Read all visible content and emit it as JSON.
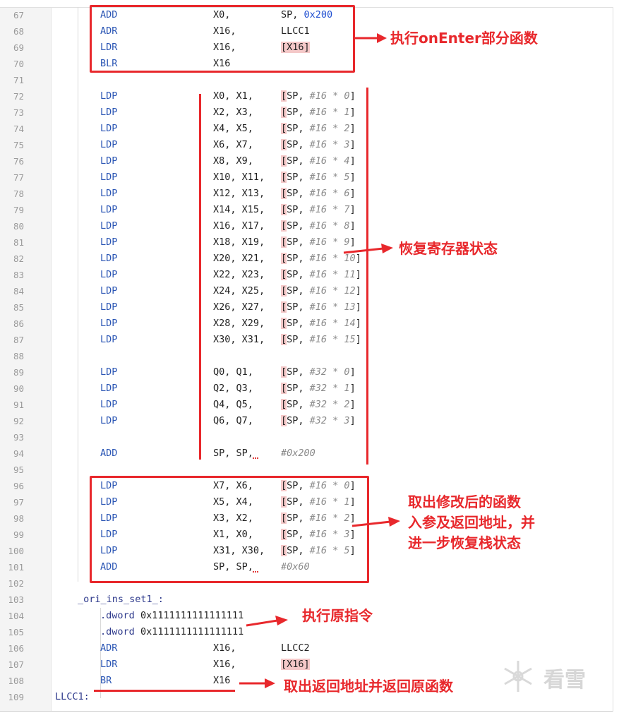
{
  "editor": {
    "lines": [
      {
        "n": "67",
        "mn": "ADD",
        "op1": "X0,",
        "op2": "SP, ",
        "num": "0x200"
      },
      {
        "n": "68",
        "mn": "ADR",
        "op1": "X16,",
        "op2": "LLCC1"
      },
      {
        "n": "69",
        "mn": "LDR",
        "op1": "X16,",
        "op2": "[X16]"
      },
      {
        "n": "70",
        "mn": "BLR",
        "op1": "X16"
      },
      {
        "n": "71"
      },
      {
        "n": "72",
        "mn": "LDP",
        "op1": "X0, X1,",
        "sp": "SP, ",
        "cm": "#16 * 0",
        "close": "]"
      },
      {
        "n": "73",
        "mn": "LDP",
        "op1": "X2, X3,",
        "sp": "SP, ",
        "cm": "#16 * 1",
        "close": "]"
      },
      {
        "n": "74",
        "mn": "LDP",
        "op1": "X4, X5,",
        "sp": "SP, ",
        "cm": "#16 * 2",
        "close": "]"
      },
      {
        "n": "75",
        "mn": "LDP",
        "op1": "X6, X7,",
        "sp": "SP, ",
        "cm": "#16 * 3",
        "close": "]"
      },
      {
        "n": "76",
        "mn": "LDP",
        "op1": "X8, X9,",
        "sp": "SP, ",
        "cm": "#16 * 4",
        "close": "]"
      },
      {
        "n": "77",
        "mn": "LDP",
        "op1": "X10, X11,",
        "sp": "SP, ",
        "cm": "#16 * 5",
        "close": "]"
      },
      {
        "n": "78",
        "mn": "LDP",
        "op1": "X12, X13,",
        "sp": "SP, ",
        "cm": "#16 * 6",
        "close": "]"
      },
      {
        "n": "79",
        "mn": "LDP",
        "op1": "X14, X15,",
        "sp": "SP, ",
        "cm": "#16 * 7",
        "close": "]"
      },
      {
        "n": "80",
        "mn": "LDP",
        "op1": "X16, X17,",
        "sp": "SP, ",
        "cm": "#16 * 8",
        "close": "]"
      },
      {
        "n": "81",
        "mn": "LDP",
        "op1": "X18, X19,",
        "sp": "SP, ",
        "cm": "#16 * 9",
        "close": "]"
      },
      {
        "n": "82",
        "mn": "LDP",
        "op1": "X20, X21,",
        "sp": "SP, ",
        "cm": "#16 * 10",
        "close": "]"
      },
      {
        "n": "83",
        "mn": "LDP",
        "op1": "X22, X23,",
        "sp": "SP, ",
        "cm": "#16 * 11",
        "close": "]"
      },
      {
        "n": "84",
        "mn": "LDP",
        "op1": "X24, X25,",
        "sp": "SP, ",
        "cm": "#16 * 12",
        "close": "]"
      },
      {
        "n": "85",
        "mn": "LDP",
        "op1": "X26, X27,",
        "sp": "SP, ",
        "cm": "#16 * 13",
        "close": "]"
      },
      {
        "n": "86",
        "mn": "LDP",
        "op1": "X28, X29,",
        "sp": "SP, ",
        "cm": "#16 * 14",
        "close": "]"
      },
      {
        "n": "87",
        "mn": "LDP",
        "op1": "X30, X31,",
        "sp": "SP, ",
        "cm": "#16 * 15",
        "close": "]"
      },
      {
        "n": "88"
      },
      {
        "n": "89",
        "mn": "LDP",
        "op1": "Q0, Q1,",
        "sp": "SP, ",
        "cm": "#32 * 0",
        "close": "]"
      },
      {
        "n": "90",
        "mn": "LDP",
        "op1": "Q2, Q3,",
        "sp": "SP, ",
        "cm": "#32 * 1",
        "close": "]"
      },
      {
        "n": "91",
        "mn": "LDP",
        "op1": "Q4, Q5,",
        "sp": "SP, ",
        "cm": "#32 * 2",
        "close": "]"
      },
      {
        "n": "92",
        "mn": "LDP",
        "op1": "Q6, Q7,",
        "sp": "SP, ",
        "cm": "#32 * 3",
        "close": "]"
      },
      {
        "n": "93"
      },
      {
        "n": "94",
        "mn": "ADD",
        "op1": "SP, SP,",
        "op2cm": "#0x200",
        "squig": true
      },
      {
        "n": "95"
      },
      {
        "n": "96",
        "mn": "LDP",
        "op1": "X7, X6,",
        "sp": "SP, ",
        "cm": "#16 * 0",
        "close": "]"
      },
      {
        "n": "97",
        "mn": "LDP",
        "op1": "X5, X4,",
        "sp": "SP, ",
        "cm": "#16 * 1",
        "close": "]"
      },
      {
        "n": "98",
        "mn": "LDP",
        "op1": "X3, X2,",
        "sp": "SP, ",
        "cm": "#16 * 2",
        "close": "]"
      },
      {
        "n": "99",
        "mn": "LDP",
        "op1": "X1, X0,",
        "sp": "SP, ",
        "cm": "#16 * 3",
        "close": "]"
      },
      {
        "n": "100",
        "mn": "LDP",
        "op1": "X31, X30,",
        "sp": "SP, ",
        "cm": "#16 * 5",
        "close": "]"
      },
      {
        "n": "101",
        "mn": "ADD",
        "op1": "SP, SP,",
        "op2cm": "#0x60",
        "squig": true
      },
      {
        "n": "102"
      },
      {
        "n": "103",
        "label": "_ori_ins_set1_:"
      },
      {
        "n": "104",
        "dir": ".dword",
        "dirv": "0x1111111111111111"
      },
      {
        "n": "105",
        "dir": ".dword",
        "dirv": "0x1111111111111111"
      },
      {
        "n": "106",
        "mn": "ADR",
        "op1": "X16,",
        "op2": "LLCC2"
      },
      {
        "n": "107",
        "mn": "LDR",
        "op1": "X16,",
        "op2": "[X16]"
      },
      {
        "n": "108",
        "mn": "BR",
        "op1": "X16"
      },
      {
        "n": "109",
        "label2": "LLCC1:"
      }
    ]
  },
  "annotations": {
    "onenter": "执行onEnter部分函数",
    "restore": "恢复寄存器状态",
    "fetch": "取出修改后的函数\n入参及返回地址，并\n进一步恢复栈状态",
    "orig": "执行原指令",
    "ret": "取出返回地址并返回原函数"
  },
  "watermark": {
    "text": "看雪",
    "icon": "snowflake-icon"
  },
  "colors": {
    "annotation": "#e8282c",
    "mnemonic": "#2a55b4",
    "number": "#1f4fd1",
    "comment": "#8a8a8a"
  }
}
